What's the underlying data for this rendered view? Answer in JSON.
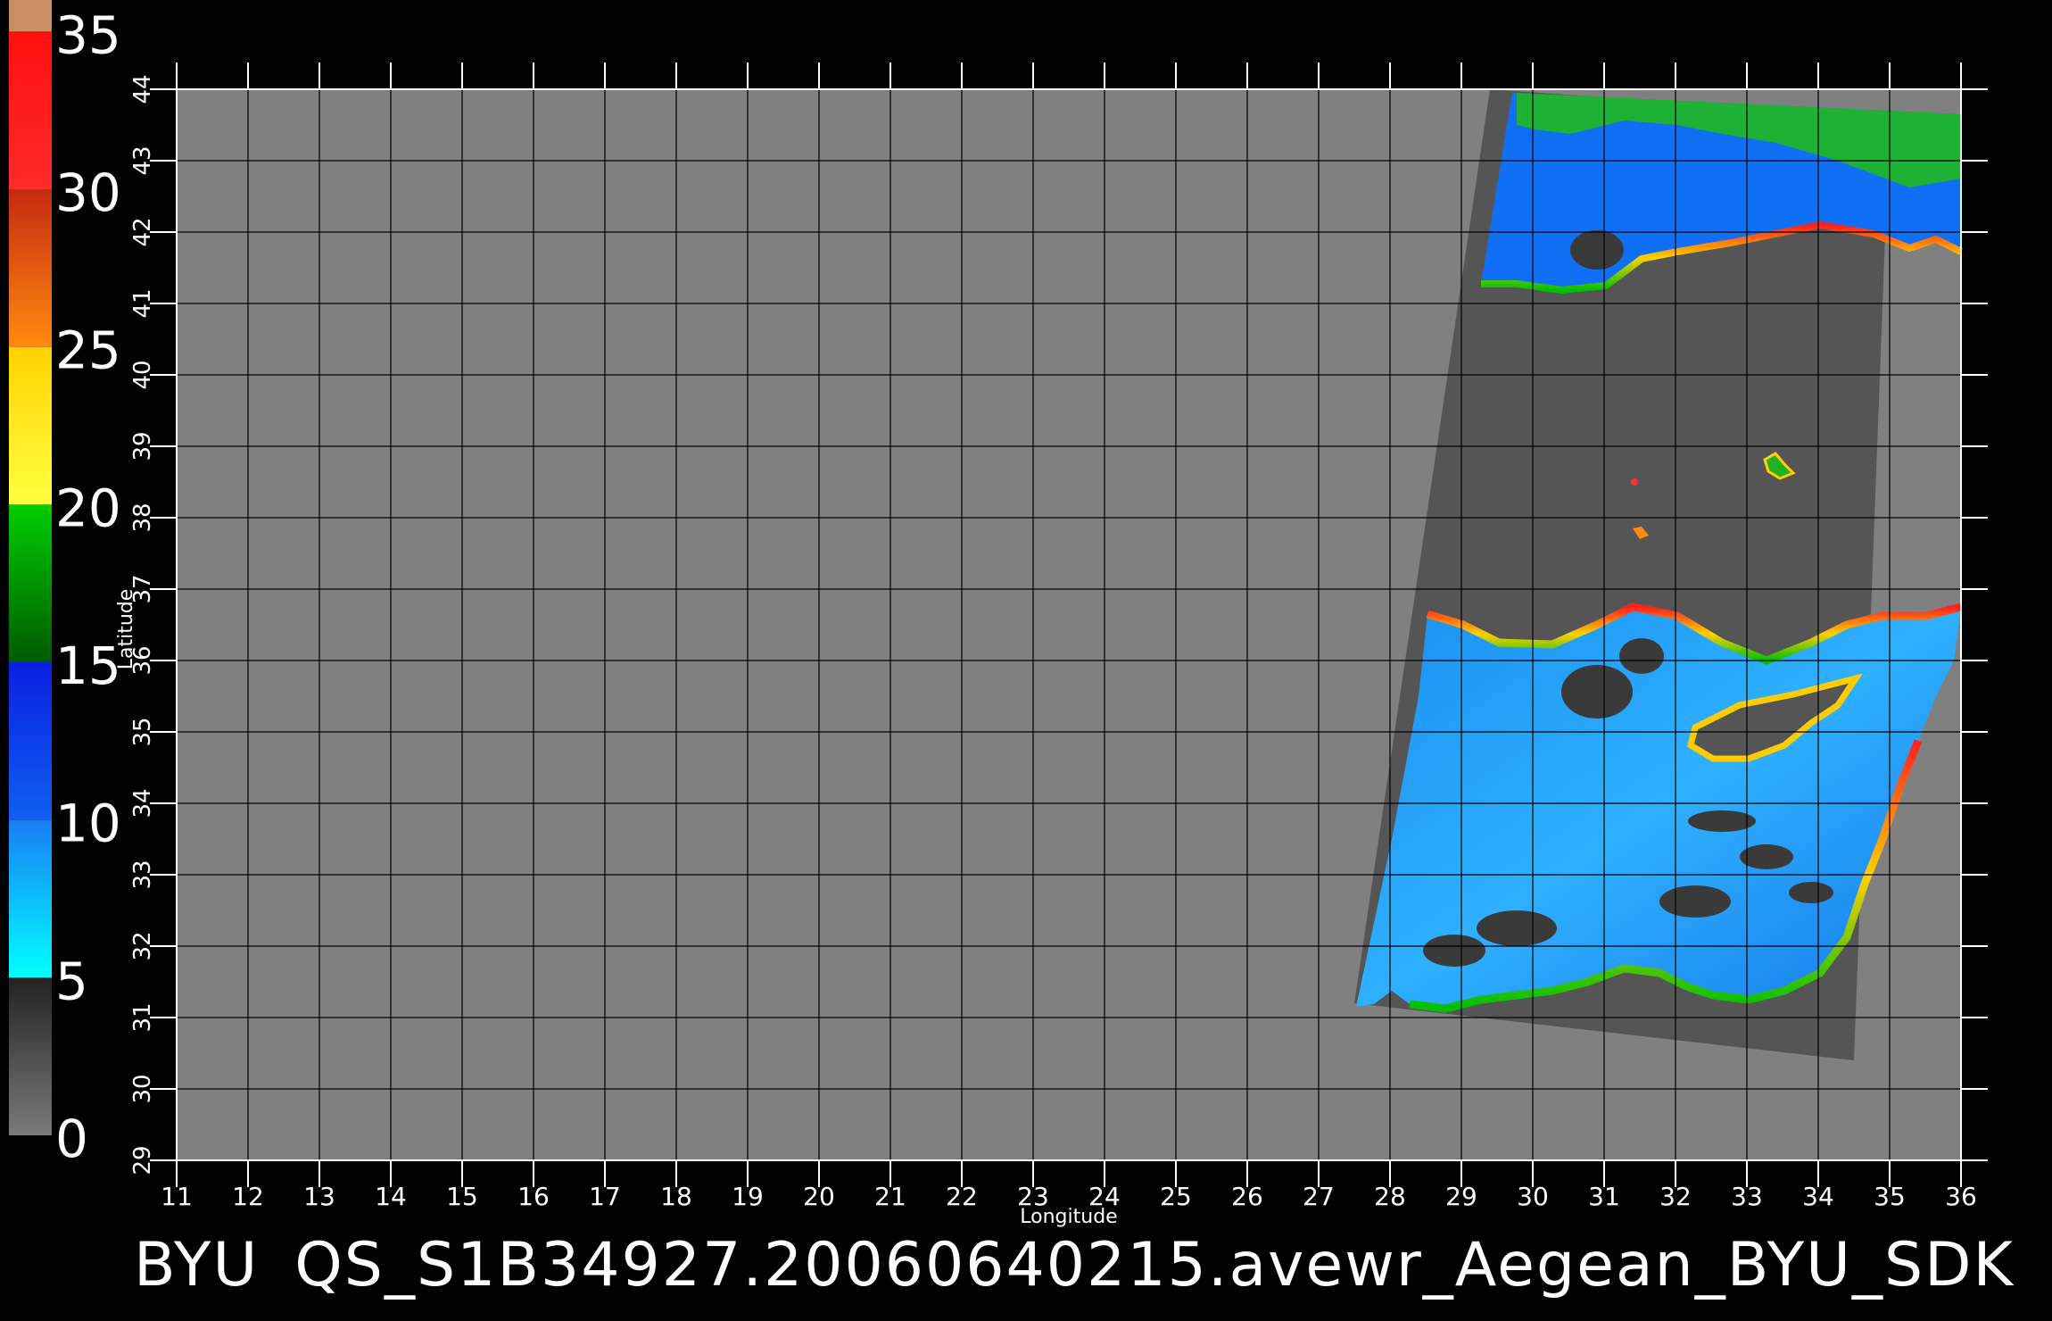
{
  "caption": {
    "prefix": "BYU",
    "filename": "QS_S1B34927.20060640215.avewr_Aegean_BYU_SDK"
  },
  "colorbar": {
    "tick_labels": [
      "0",
      "5",
      "10",
      "15",
      "20",
      "25",
      "30",
      "35"
    ],
    "segments": [
      {
        "from": 0,
        "to": 5,
        "color_top": "#222222",
        "color_bottom": "#7a7a7a"
      },
      {
        "from": 5,
        "to": 10,
        "color_top": "#1a7ef5",
        "color_bottom": "#00ffff"
      },
      {
        "from": 10,
        "to": 15,
        "color_top": "#0a1fe0",
        "color_bottom": "#1060f0"
      },
      {
        "from": 15,
        "to": 20,
        "color_top": "#00cc00",
        "color_bottom": "#005a00"
      },
      {
        "from": 20,
        "to": 25,
        "color_top": "#ffd200",
        "color_bottom": "#ffff40"
      },
      {
        "from": 25,
        "to": 30,
        "color_top": "#c42a10",
        "color_bottom": "#ff8a10"
      },
      {
        "from": 30,
        "to": 35,
        "color_top": "#ff1010",
        "color_bottom": "#ff2a2a"
      },
      {
        "from": 35,
        "to": 36,
        "color_top": "#c89060",
        "color_bottom": "#c89060"
      }
    ]
  },
  "map": {
    "xlabel": "Longitude",
    "ylabel": "Latitude",
    "lon_range": [
      11,
      36
    ],
    "lat_range": [
      29,
      44
    ],
    "lon_ticks": [
      "11",
      "12",
      "13",
      "14",
      "15",
      "16",
      "17",
      "18",
      "19",
      "20",
      "21",
      "22",
      "23",
      "24",
      "25",
      "26",
      "27",
      "28",
      "29",
      "30",
      "31",
      "32",
      "33",
      "34",
      "35",
      "36"
    ],
    "lat_ticks": [
      "29",
      "30",
      "31",
      "32",
      "33",
      "34",
      "35",
      "36",
      "37",
      "38",
      "39",
      "40",
      "41",
      "42",
      "43",
      "44"
    ],
    "background_color": "#808080",
    "swath_color": "#555555",
    "gridline_color": "#000000",
    "swath_corners_lonlat": [
      [
        29.4,
        44.0
      ],
      [
        35.0,
        43.6
      ],
      [
        34.5,
        30.4
      ],
      [
        27.5,
        31.2
      ]
    ]
  }
}
